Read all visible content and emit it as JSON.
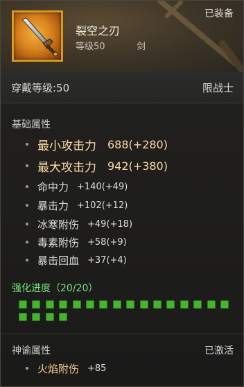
{
  "item": {
    "name": "裂空之刃",
    "level": "等级50",
    "type": "剑",
    "status": "已装备"
  },
  "requirements": {
    "level": "穿戴等级:50",
    "class": "限战士"
  },
  "base_attributes": {
    "title": "基础属性",
    "items": [
      {
        "name": "最小攻击力",
        "value": "688(+280)"
      },
      {
        "name": "最大攻击力",
        "value": "942(+380)"
      },
      {
        "name": "命中力",
        "value": "+140(+49)"
      },
      {
        "name": "暴击力",
        "value": "+102(+12)"
      },
      {
        "name": "冰寒附伤",
        "value": "+49(+18)"
      },
      {
        "name": "毒素附伤",
        "value": "+58(+9)"
      },
      {
        "name": "暴击回血",
        "value": "+37(+4)"
      }
    ]
  },
  "enhancement": {
    "label": "强化进度（20/20）",
    "current": 20,
    "max": 20
  },
  "oracle": {
    "title": "神谕属性",
    "status": "已激活",
    "attr_name": "火焰附伤",
    "attr_value": "+85"
  },
  "colors": {
    "highlight_text": "#ffd9a8",
    "enhance_green": "#46b42c",
    "icon_border": "#d49a1f"
  }
}
